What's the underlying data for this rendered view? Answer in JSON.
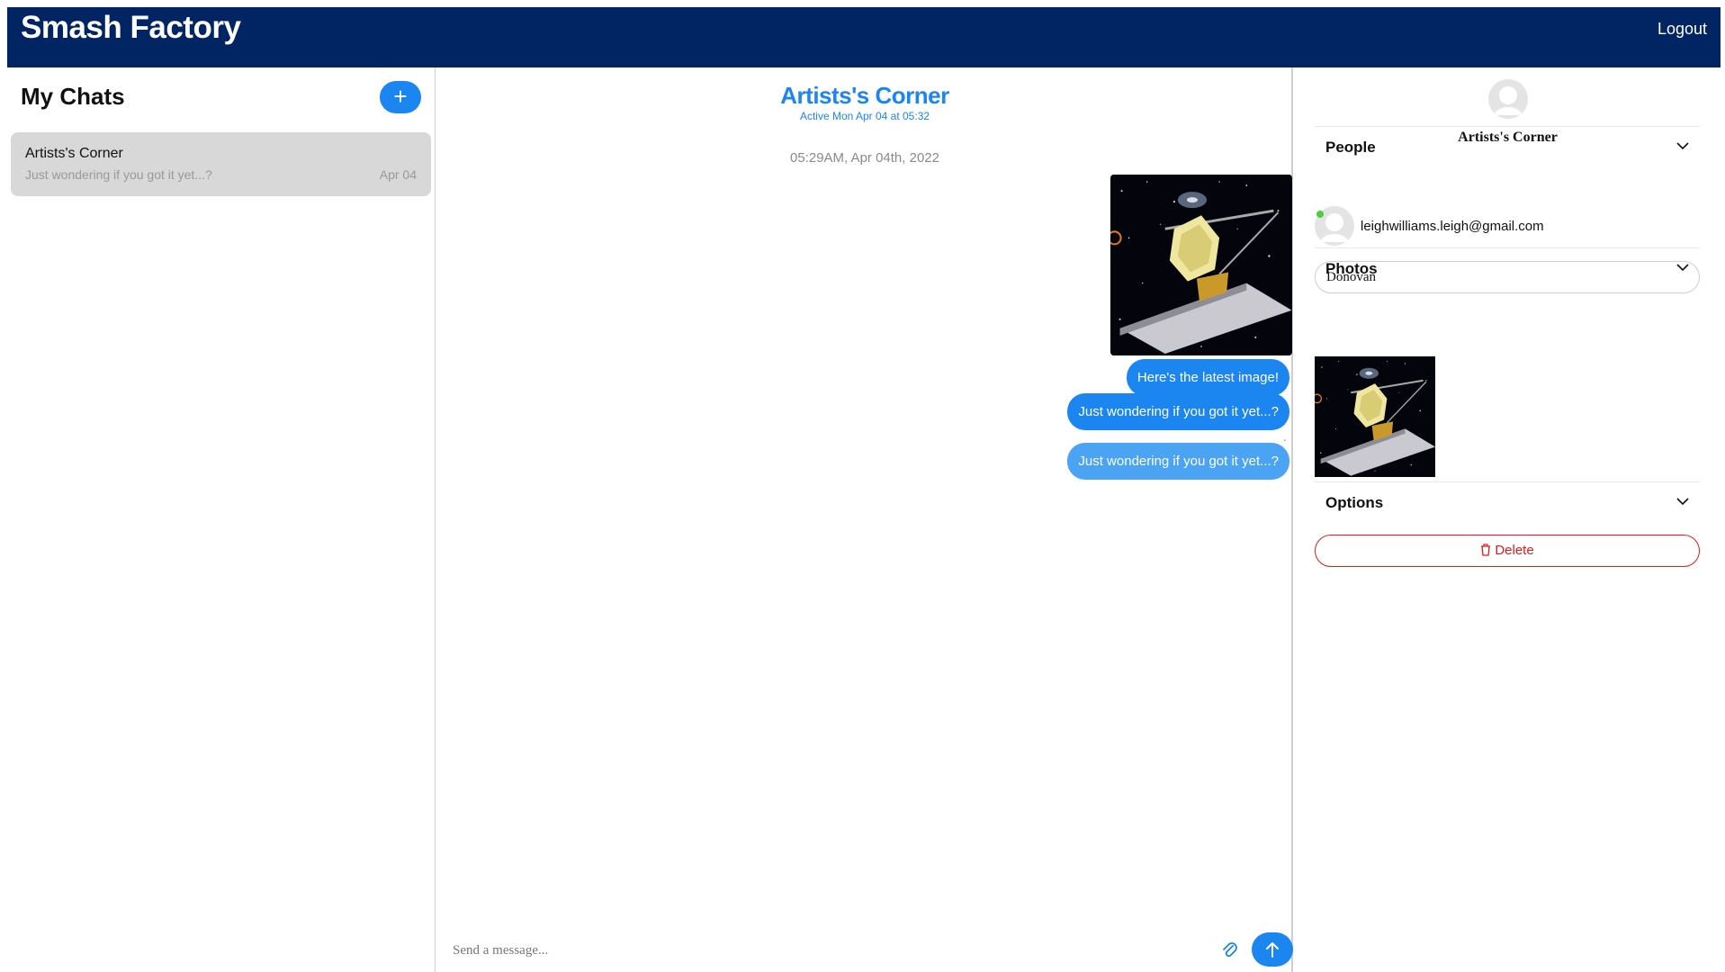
{
  "app": {
    "brand": "Smash Factory",
    "logout_label": "Logout"
  },
  "sidebar": {
    "title": "My Chats",
    "new_chat_icon": "plus-icon",
    "chats": [
      {
        "name": "Artists's Corner",
        "preview": "Just wondering if you got it yet...?",
        "date": "Apr 04"
      }
    ]
  },
  "conversation": {
    "title": "Artists's Corner",
    "status": "Active Mon Apr 04 at 05:32",
    "timestamp": "05:29AM, Apr 04th, 2022",
    "messages": [
      {
        "type": "image",
        "alt": "telescope-space-image"
      },
      {
        "type": "text",
        "text": "Here's the latest image!"
      },
      {
        "type": "text",
        "text": "Just wondering if you got it yet...?"
      },
      {
        "type": "text",
        "text": "Just wondering if you got it yet...?",
        "pending": true
      }
    ],
    "composer": {
      "placeholder": "Send a message...",
      "attach_icon": "paperclip-icon",
      "send_icon": "arrow-up-icon"
    }
  },
  "details": {
    "group_name": "Artists's Corner",
    "people": {
      "label": "People",
      "members": [
        {
          "email": "leighwilliams.leigh@gmail.com",
          "online": true
        }
      ],
      "add_input_value": "Donovan"
    },
    "photos": {
      "label": "Photos"
    },
    "options": {
      "label": "Options",
      "delete_label": "Delete"
    }
  },
  "colors": {
    "header": "#002562",
    "accent": "#1b85f0",
    "danger": "#e31b1b",
    "online": "#4ccd3d"
  }
}
